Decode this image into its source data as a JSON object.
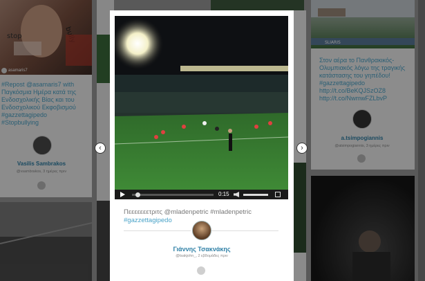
{
  "background_cards": {
    "left_top": {
      "hashtag_text": "#Repost @asamaris7 with Παγκόσμια Ημέρα κατά της Ενδοσχολικής Βίας και του Ενδοσχολικού Εκφοβισμού #gazzettagipedo #Stopbullying",
      "photo_username": "asamaris7",
      "username": "Vasilis Sambrakos",
      "meta": "@vsambrakos, 3 ημέρες πριν"
    },
    "right_top": {
      "text": "Στον αέρα το Πανθρακικός-Ολυμπιακός λόγω της τραγικής κατάστασης του γηπέδου! #gazzettagipedo http://t.co/BeKQJSzOZ8 http://t.co/NwmwFZLbvP",
      "username": "a.tsimpogiannis",
      "meta": "@atsimpogiannis, 3 ημέρες πριν"
    }
  },
  "modal": {
    "caption_plain": "Πεεεεεεετριτς @mladenpetric #mladenpetric",
    "caption_tag": "#gazzettagipedo",
    "username": "Γιάννης Τσακνάκης",
    "meta": "@tsakjohn_, 2 εβδομάδες πριν",
    "video": {
      "time": "0:15",
      "progress_fraction": 0.04
    }
  },
  "navigation": {
    "prev_icon": "‹",
    "next_icon": "›"
  },
  "colors": {
    "link": "#4aa3c8",
    "username": "#2d7fa5"
  }
}
